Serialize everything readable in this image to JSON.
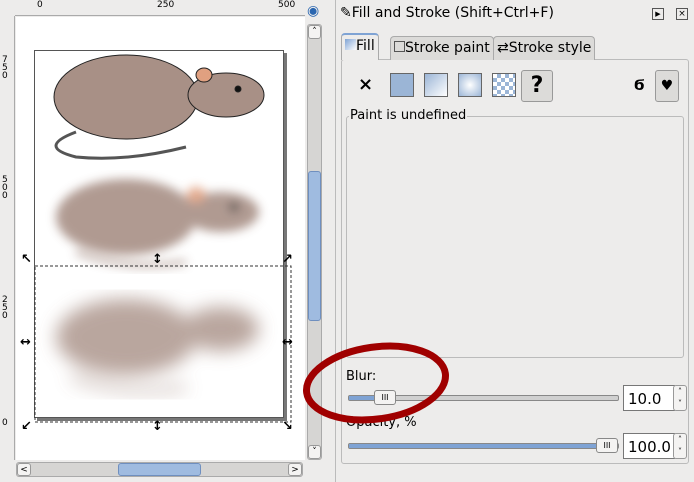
{
  "ruler_top": {
    "labels": [
      "0",
      "250",
      "500"
    ]
  },
  "ruler_left": {
    "labels": [
      "750",
      "500",
      "250",
      "0"
    ]
  },
  "dialog": {
    "title": "Fill and Stroke (Shift+Ctrl+F)",
    "tabs": [
      {
        "label": "Fill",
        "active": true
      },
      {
        "label": "Stroke paint"
      },
      {
        "label": "Stroke style"
      }
    ],
    "paint_buttons": [
      "no-paint",
      "flat-color",
      "linear-gradient",
      "radial-gradient",
      "pattern",
      "unset"
    ],
    "paint_status": "Paint is undefined",
    "blur": {
      "label": "Blur:",
      "value": "10.0",
      "fraction": 0.1
    },
    "opacity": {
      "label": "Opacity, %",
      "value": "100.0",
      "fraction": 1.0
    }
  },
  "colors": {
    "rat": "#a89086",
    "accent": "#7fa3d4",
    "annotation": "#a00000"
  }
}
